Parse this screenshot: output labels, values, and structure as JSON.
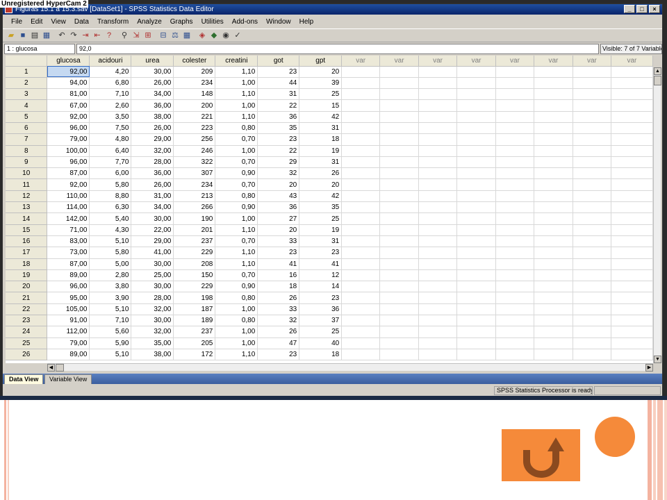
{
  "hypercam_label": "Unregistered HyperCam 2",
  "window": {
    "title": "Figuras 15.1 a 15.3.sav [DataSet1] - SPSS Statistics Data Editor"
  },
  "menu": [
    "File",
    "Edit",
    "View",
    "Data",
    "Transform",
    "Analyze",
    "Graphs",
    "Utilities",
    "Add-ons",
    "Window",
    "Help"
  ],
  "toolbar_icons": [
    "open-icon",
    "save-icon",
    "print-icon",
    "dialog-recall-icon",
    "undo-icon",
    "redo-icon",
    "goto-case-icon",
    "goto-variable-icon",
    "variables-icon",
    "find-icon",
    "insert-cases-icon",
    "insert-variable-icon",
    "split-file-icon",
    "weight-cases-icon",
    "select-cases-icon",
    "value-labels-icon",
    "use-sets-icon",
    "show-all-icon",
    "spell-check-icon"
  ],
  "cell_editor": {
    "reference": "1 : glucosa",
    "value": "92,0",
    "visible": "Visible: 7 of 7 Variables"
  },
  "columns": [
    "glucosa",
    "acidouri",
    "urea",
    "colester",
    "creatini",
    "got",
    "gpt",
    "var",
    "var",
    "var",
    "var",
    "var",
    "var",
    "var",
    "var"
  ],
  "rows": [
    [
      "1",
      "92,00",
      "4,20",
      "30,00",
      "209",
      "1,10",
      "23",
      "20"
    ],
    [
      "2",
      "94,00",
      "6,80",
      "26,00",
      "234",
      "1,00",
      "44",
      "39"
    ],
    [
      "3",
      "81,00",
      "7,10",
      "34,00",
      "148",
      "1,10",
      "31",
      "25"
    ],
    [
      "4",
      "67,00",
      "2,60",
      "36,00",
      "200",
      "1,00",
      "22",
      "15"
    ],
    [
      "5",
      "92,00",
      "3,50",
      "38,00",
      "221",
      "1,10",
      "36",
      "42"
    ],
    [
      "6",
      "96,00",
      "7,50",
      "26,00",
      "223",
      "0,80",
      "35",
      "31"
    ],
    [
      "7",
      "79,00",
      "4,80",
      "29,00",
      "256",
      "0,70",
      "23",
      "18"
    ],
    [
      "8",
      "100,00",
      "6,40",
      "32,00",
      "246",
      "1,00",
      "22",
      "19"
    ],
    [
      "9",
      "96,00",
      "7,70",
      "28,00",
      "322",
      "0,70",
      "29",
      "31"
    ],
    [
      "10",
      "87,00",
      "6,00",
      "36,00",
      "307",
      "0,90",
      "32",
      "26"
    ],
    [
      "11",
      "92,00",
      "5,80",
      "26,00",
      "234",
      "0,70",
      "20",
      "20"
    ],
    [
      "12",
      "110,00",
      "8,80",
      "31,00",
      "213",
      "0,80",
      "43",
      "42"
    ],
    [
      "13",
      "114,00",
      "6,30",
      "34,00",
      "266",
      "0,90",
      "36",
      "35"
    ],
    [
      "14",
      "142,00",
      "5,40",
      "30,00",
      "190",
      "1,00",
      "27",
      "25"
    ],
    [
      "15",
      "71,00",
      "4,30",
      "22,00",
      "201",
      "1,10",
      "20",
      "19"
    ],
    [
      "16",
      "83,00",
      "5,10",
      "29,00",
      "237",
      "0,70",
      "33",
      "31"
    ],
    [
      "17",
      "73,00",
      "5,80",
      "41,00",
      "229",
      "1,10",
      "23",
      "23"
    ],
    [
      "18",
      "87,00",
      "5,00",
      "30,00",
      "208",
      "1,10",
      "41",
      "41"
    ],
    [
      "19",
      "89,00",
      "2,80",
      "25,00",
      "150",
      "0,70",
      "16",
      "12"
    ],
    [
      "20",
      "96,00",
      "3,80",
      "30,00",
      "229",
      "0,90",
      "18",
      "14"
    ],
    [
      "21",
      "95,00",
      "3,90",
      "28,00",
      "198",
      "0,80",
      "26",
      "23"
    ],
    [
      "22",
      "105,00",
      "5,10",
      "32,00",
      "187",
      "1,00",
      "33",
      "36"
    ],
    [
      "23",
      "91,00",
      "7,10",
      "30,00",
      "189",
      "0,80",
      "32",
      "37"
    ],
    [
      "24",
      "112,00",
      "5,60",
      "32,00",
      "237",
      "1,00",
      "26",
      "25"
    ],
    [
      "25",
      "79,00",
      "5,90",
      "35,00",
      "205",
      "1,00",
      "47",
      "40"
    ],
    [
      "26",
      "89,00",
      "5,10",
      "38,00",
      "172",
      "1,10",
      "23",
      "18"
    ]
  ],
  "tabs": {
    "data_view": "Data View",
    "variable_view": "Variable View"
  },
  "status": "SPSS Statistics  Processor is ready",
  "colors": {
    "accent_orange": "#f58a3a",
    "back_arrow": "#8b4a1f",
    "stripe_pink": "#f4b3a0"
  }
}
